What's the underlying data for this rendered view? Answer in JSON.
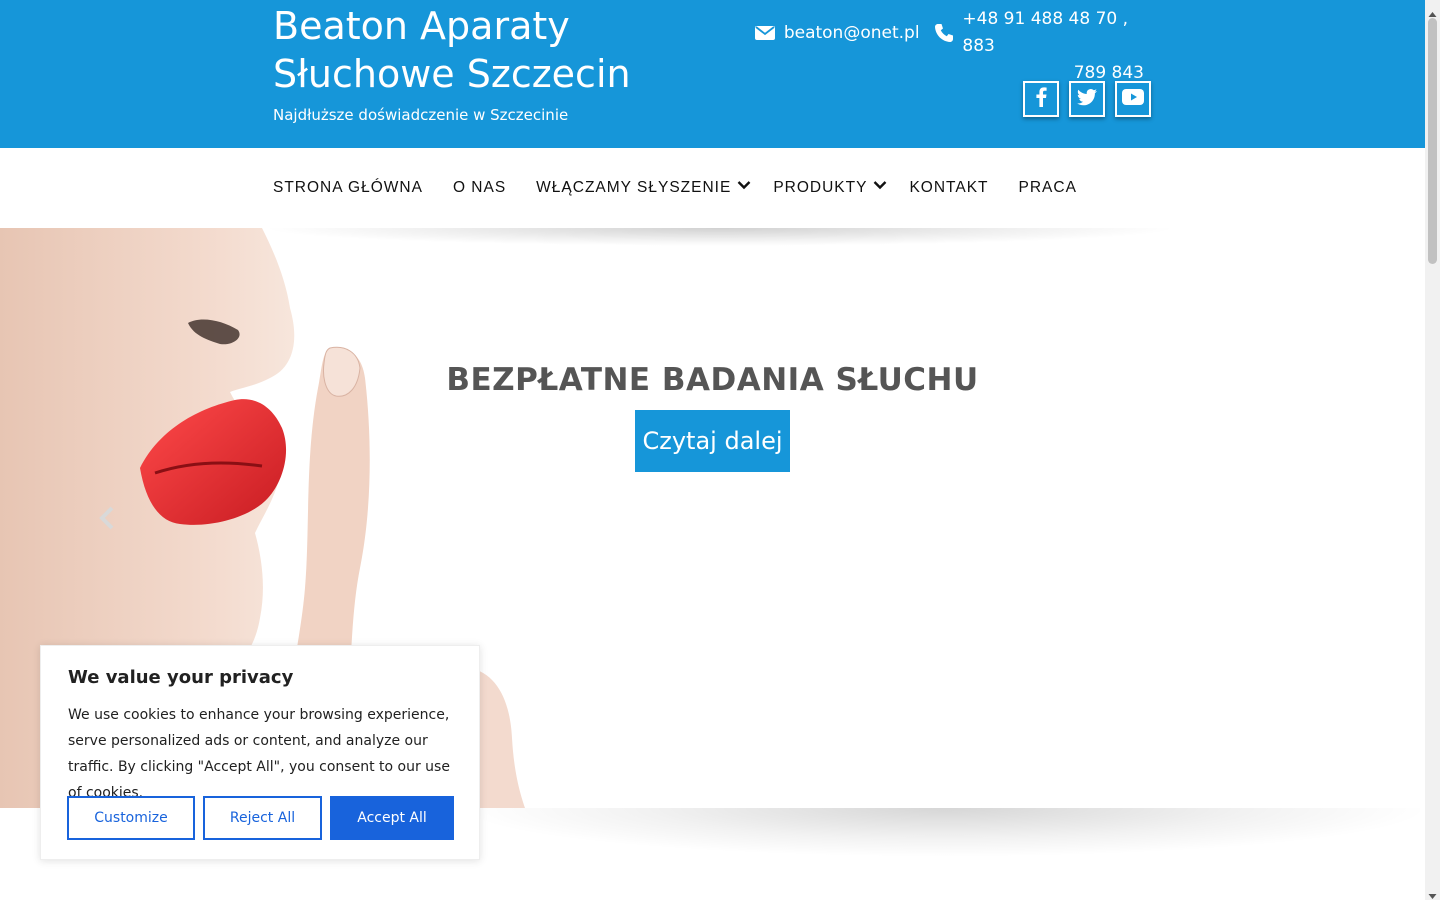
{
  "header": {
    "site_title": "Beaton Aparaty Słuchowe Szczecin",
    "tagline": "Najdłuższe doświadczenie w Szczecinie",
    "email": "beaton@onet.pl",
    "phone_line1": "+48 91 488 48 70 , 883",
    "phone_line2": "789 843",
    "socials": [
      "facebook-icon",
      "twitter-icon",
      "youtube-icon"
    ],
    "background_color": "#1696d9"
  },
  "nav": {
    "items": [
      {
        "label": "STRONA GŁÓWNA"
      },
      {
        "label": "O NAS"
      },
      {
        "label": "WŁĄCZAMY SŁYSZENIE",
        "dropdown": true
      },
      {
        "label": "PRODUKTY",
        "dropdown": true
      },
      {
        "label": "KONTAKT"
      },
      {
        "label": "PRACA"
      }
    ]
  },
  "hero": {
    "title": "BEZPŁATNE BADANIA SŁUCHU",
    "button_label": "Czytaj dalej",
    "accent_color": "#1696d9"
  },
  "cookie": {
    "title": "We value your privacy",
    "text": "We use cookies to enhance your browsing experience, serve personalized ads or content, and analyze our traffic. By clicking \"Accept All\", you consent to our use of cookies.",
    "customize_label": "Customize",
    "reject_label": "Reject All",
    "accept_label": "Accept All",
    "button_color": "#1863dc"
  }
}
